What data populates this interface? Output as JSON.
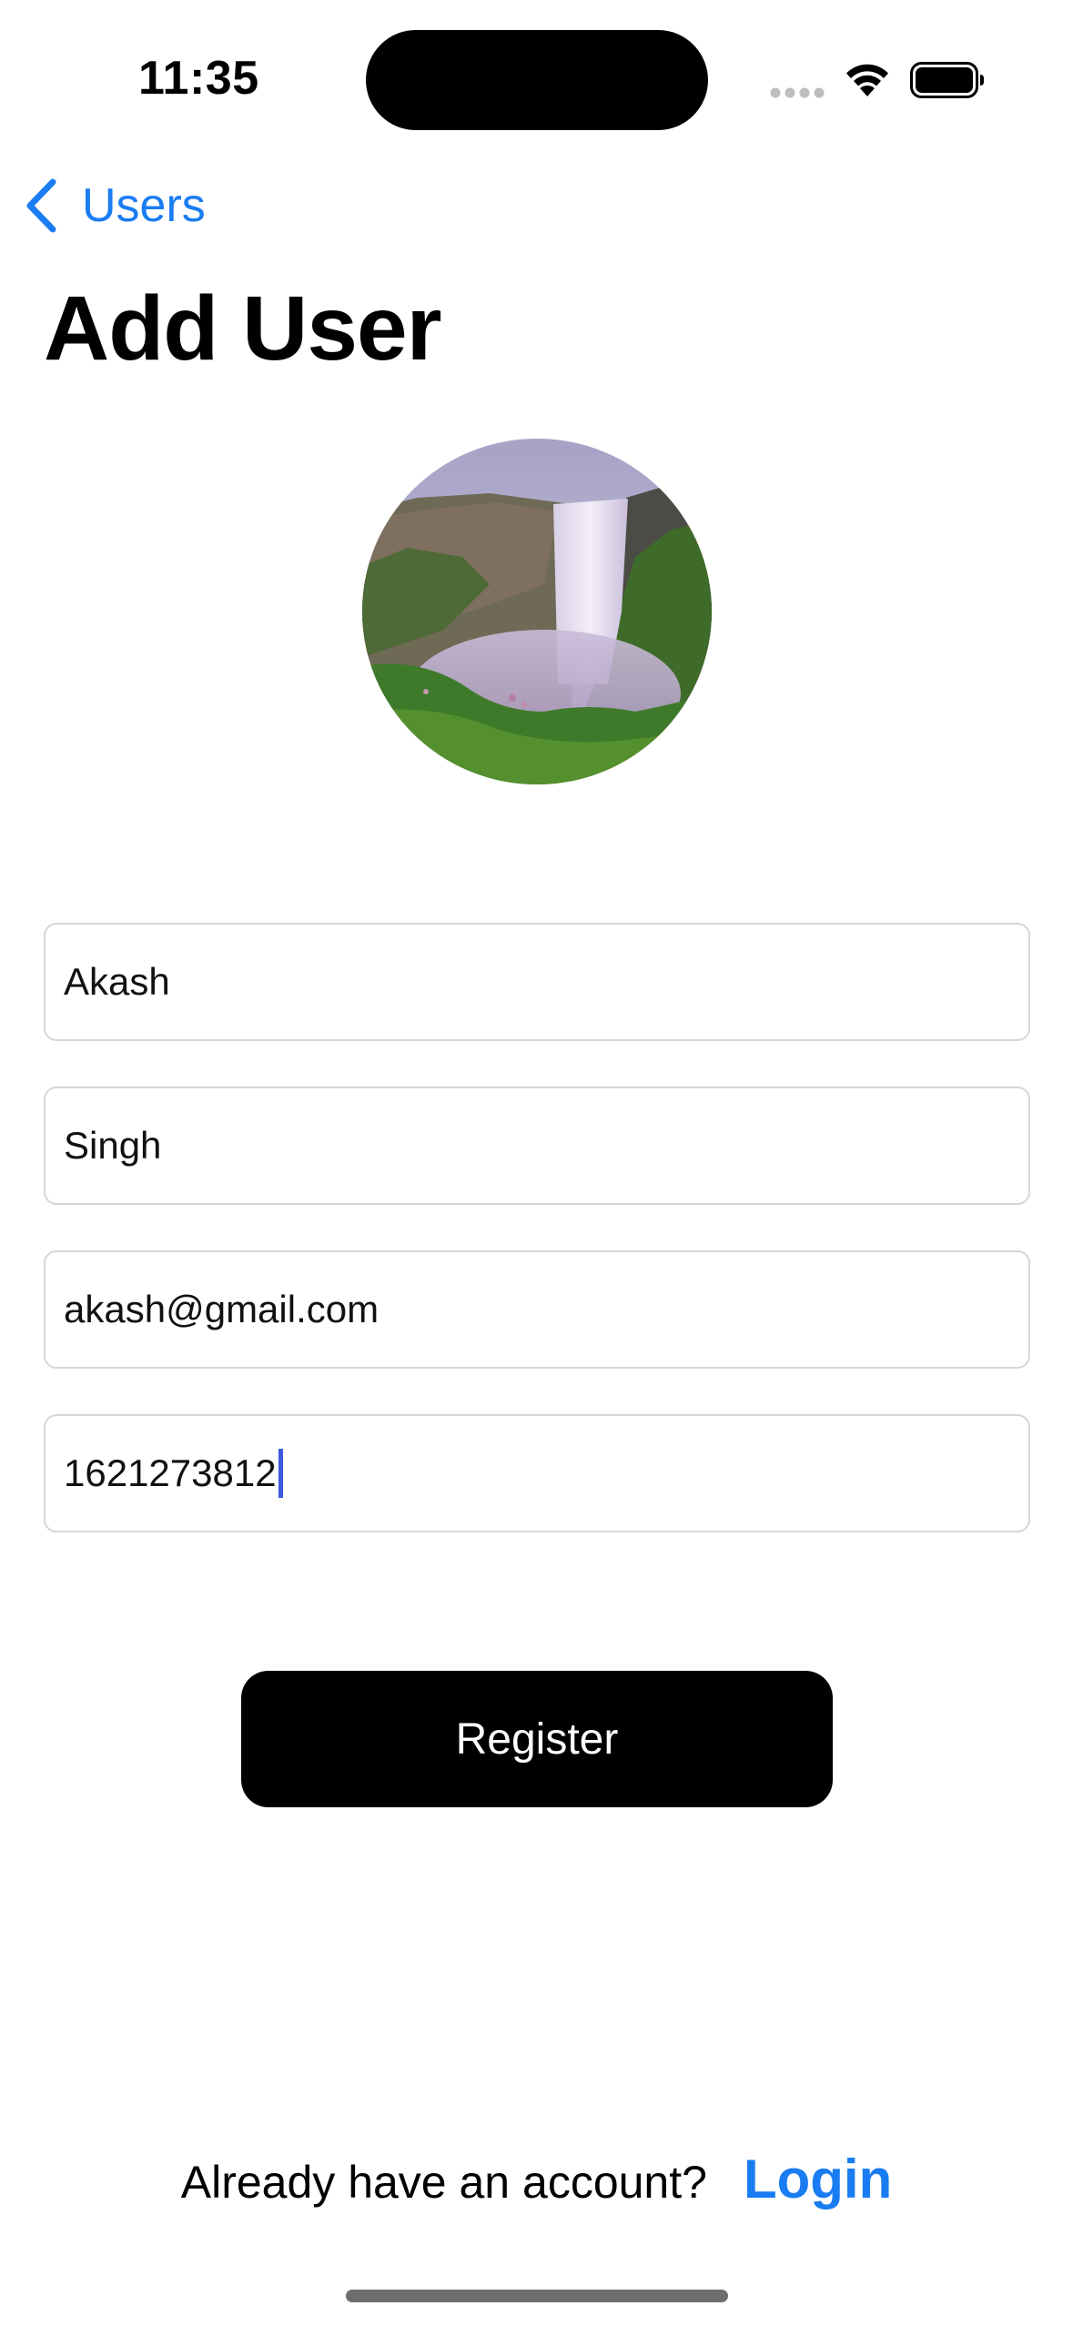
{
  "status_bar": {
    "time": "11:35"
  },
  "nav": {
    "back_label": "Users",
    "title": "Add User"
  },
  "form": {
    "first_name": "Akash",
    "last_name": "Singh",
    "email": "akash@gmail.com",
    "phone": "1621273812"
  },
  "actions": {
    "register_label": "Register"
  },
  "footer": {
    "prompt": "Already have an account?",
    "login_label": "Login"
  },
  "colors": {
    "accent": "#1a7cf2",
    "button_bg": "#000000",
    "caret": "#3b5bdb"
  }
}
